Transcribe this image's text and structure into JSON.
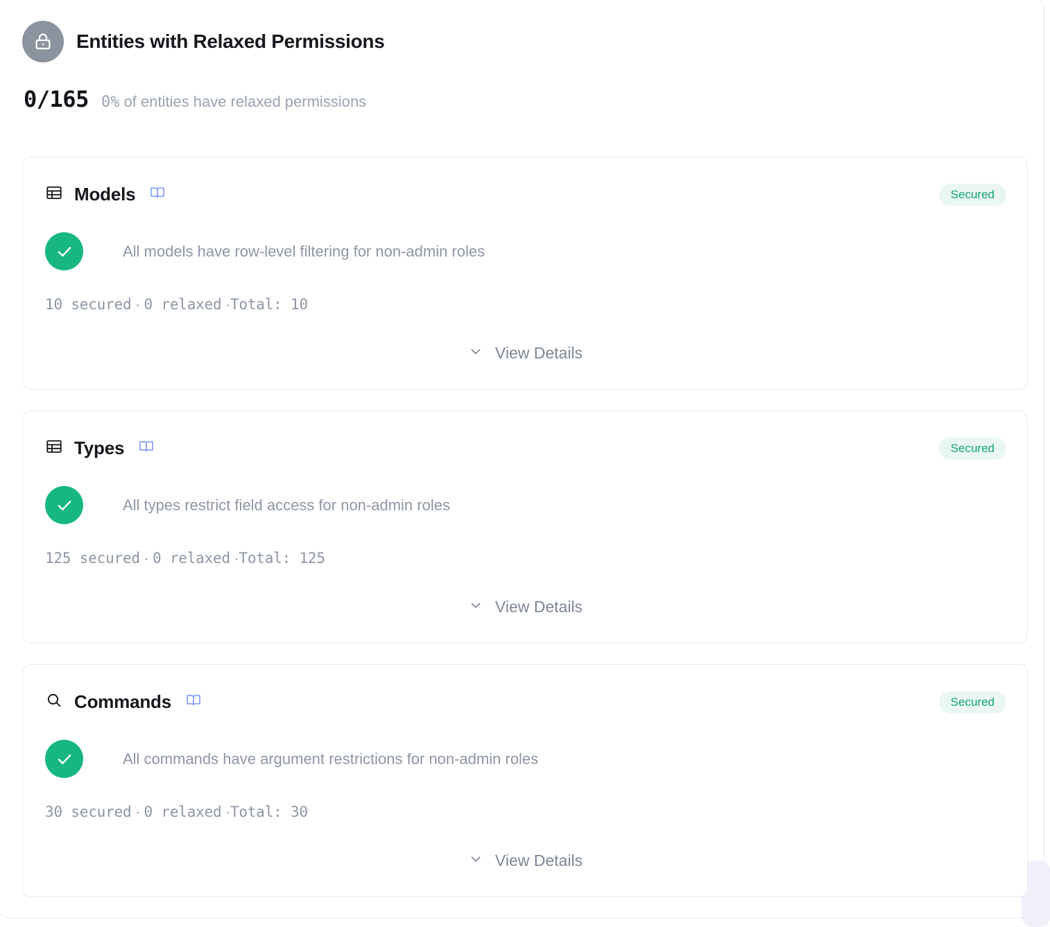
{
  "header": {
    "icon": "lock-icon",
    "title": "Entities with Relaxed Permissions",
    "count": "0/165",
    "subtitle_number": "0%",
    "subtitle_text": " of entities have relaxed permissions"
  },
  "colors": {
    "accent_green": "#17b77f",
    "badge_bg": "#e9f7f0",
    "badge_text": "#12a474",
    "book_icon": "#8ba2f7",
    "avatar_bg": "#8b939f",
    "muted_text": "#8d96a4",
    "card_border": "#e9eaee"
  },
  "cards": [
    {
      "icon": "table-icon",
      "title": "Models",
      "docs_icon": "book-icon",
      "badge": "Secured",
      "status_icon": "check-circle-icon",
      "description": "All models have row-level filtering for non-admin roles",
      "stats_secured": "10 secured",
      "stats_sep1": " · ",
      "stats_relaxed": "0 relaxed",
      "stats_sep2": " ·",
      "stats_total": "Total: 10",
      "view_details_label": "View Details",
      "chevron": "chevron-down-icon"
    },
    {
      "icon": "table-icon",
      "title": "Types",
      "docs_icon": "book-icon",
      "badge": "Secured",
      "status_icon": "check-circle-icon",
      "description": "All types restrict field access for non-admin roles",
      "stats_secured": "125 secured",
      "stats_sep1": " · ",
      "stats_relaxed": "0 relaxed",
      "stats_sep2": " ·",
      "stats_total": "Total: 125",
      "view_details_label": "View Details",
      "chevron": "chevron-down-icon"
    },
    {
      "icon": "search-icon",
      "title": "Commands",
      "docs_icon": "book-icon",
      "badge": "Secured",
      "status_icon": "check-circle-icon",
      "description": "All commands have argument restrictions for non-admin roles",
      "stats_secured": "30 secured",
      "stats_sep1": " · ",
      "stats_relaxed": "0 relaxed",
      "stats_sep2": " ·",
      "stats_total": "Total: 30",
      "view_details_label": "View Details",
      "chevron": "chevron-down-icon"
    }
  ]
}
